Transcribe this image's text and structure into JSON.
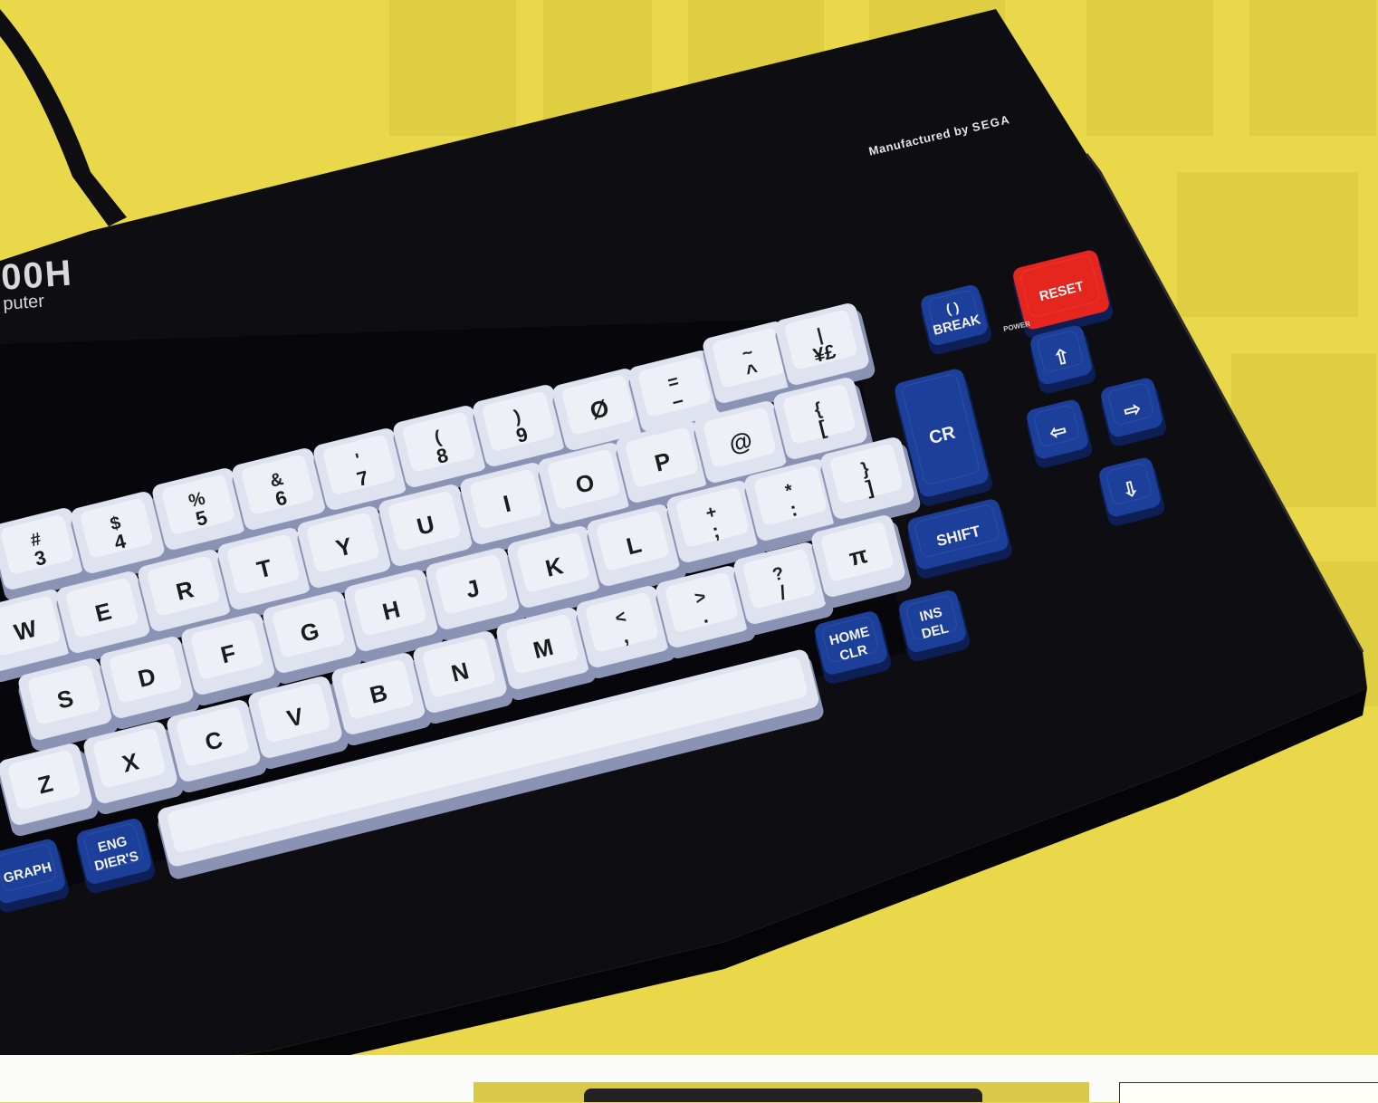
{
  "machine": {
    "model_text": "00H",
    "sub_text": "puter",
    "manufacturer_prefix": "Manufactured by",
    "manufacturer_brand": "SEGA",
    "power_label": "POWER"
  },
  "colors": {
    "background": "#e8d84a",
    "casing": "#0d0d12",
    "key_light": "#dfe3f0",
    "key_blue": "#1c3f9a",
    "key_red": "#e4261e"
  },
  "keys": {
    "row_numbers": [
      {
        "upper": "#",
        "lower": "3"
      },
      {
        "upper": "$",
        "lower": "4"
      },
      {
        "upper": "%",
        "lower": "5"
      },
      {
        "upper": "&",
        "lower": "6"
      },
      {
        "upper": "'",
        "lower": "7"
      },
      {
        "upper": "(",
        "lower": "8"
      },
      {
        "upper": ")",
        "lower": "9"
      },
      {
        "upper": "",
        "lower": "Ø"
      },
      {
        "upper": "=",
        "lower": "–"
      },
      {
        "upper": "~",
        "lower": "^"
      },
      {
        "upper": "|",
        "lower": "¥£"
      }
    ],
    "row_qwerty": [
      "W",
      "E",
      "R",
      "T",
      "Y",
      "U",
      "I",
      "O",
      "P",
      "@"
    ],
    "row_qwerty_extra": {
      "upper": "{",
      "lower": "["
    },
    "row_home": [
      "S",
      "D",
      "F",
      "G",
      "H",
      "J",
      "K",
      "L"
    ],
    "row_home_extra": [
      {
        "upper": "+",
        "lower": ";"
      },
      {
        "upper": "*",
        "lower": ":"
      },
      {
        "upper": "}",
        "lower": "]"
      }
    ],
    "row_bottom": [
      "Z",
      "X",
      "C",
      "V",
      "B",
      "N",
      "M"
    ],
    "row_bottom_extra": [
      {
        "upper": "<",
        "lower": ","
      },
      {
        "upper": ">",
        "lower": "."
      },
      {
        "upper": "?",
        "lower": "/"
      },
      {
        "upper": "",
        "lower": "π"
      }
    ],
    "blue": {
      "break_top": "( )",
      "break": "BREAK",
      "cr": "CR",
      "shift": "SHIFT",
      "home_top": "HOME",
      "home_bottom": "CLR",
      "ins_top": "INS",
      "ins_bottom": "DEL",
      "eng_top": "ENG",
      "eng_bottom": "DIER'S",
      "graph": "GRAPH"
    },
    "reset": "RESET",
    "arrows": [
      "⇧",
      "⇦",
      "⇨",
      "⇩"
    ]
  }
}
